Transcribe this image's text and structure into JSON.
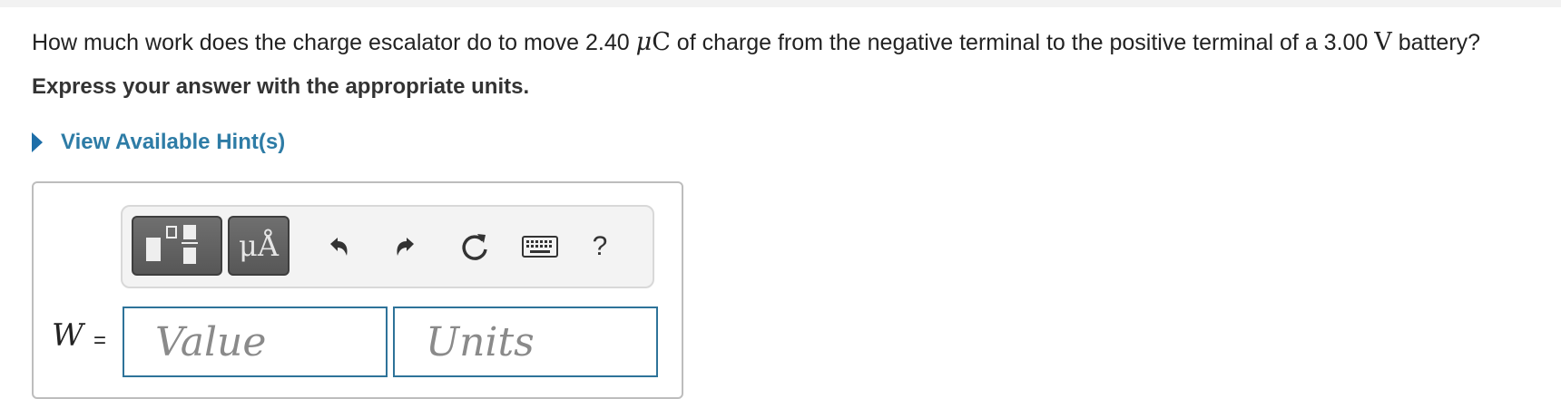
{
  "question": {
    "text_before": "How much work does the charge escalator do to move 2.40 ",
    "charge_unit_mu": "μ",
    "charge_unit_C": "C",
    "text_middle": " of charge from the negative terminal to the positive terminal of a 3.00 ",
    "voltage_unit": "V",
    "text_after": " battery?"
  },
  "instruction": "Express your answer with the appropriate units.",
  "hint": {
    "label": "View Available Hint(s)"
  },
  "toolbar": {
    "units_button_label": "μÅ",
    "help_label": "?",
    "icons": [
      "fraction-template-icon",
      "units-icon",
      "undo-icon",
      "redo-icon",
      "reset-icon",
      "keyboard-icon",
      "help-icon"
    ]
  },
  "answer": {
    "variable": "W",
    "equals": "=",
    "value_placeholder": "Value",
    "units_placeholder": "Units",
    "value": "",
    "units": ""
  },
  "colors": {
    "link": "#2e7ca6",
    "hint_arrow": "#1d6ea8",
    "field_border": "#2e7399"
  }
}
